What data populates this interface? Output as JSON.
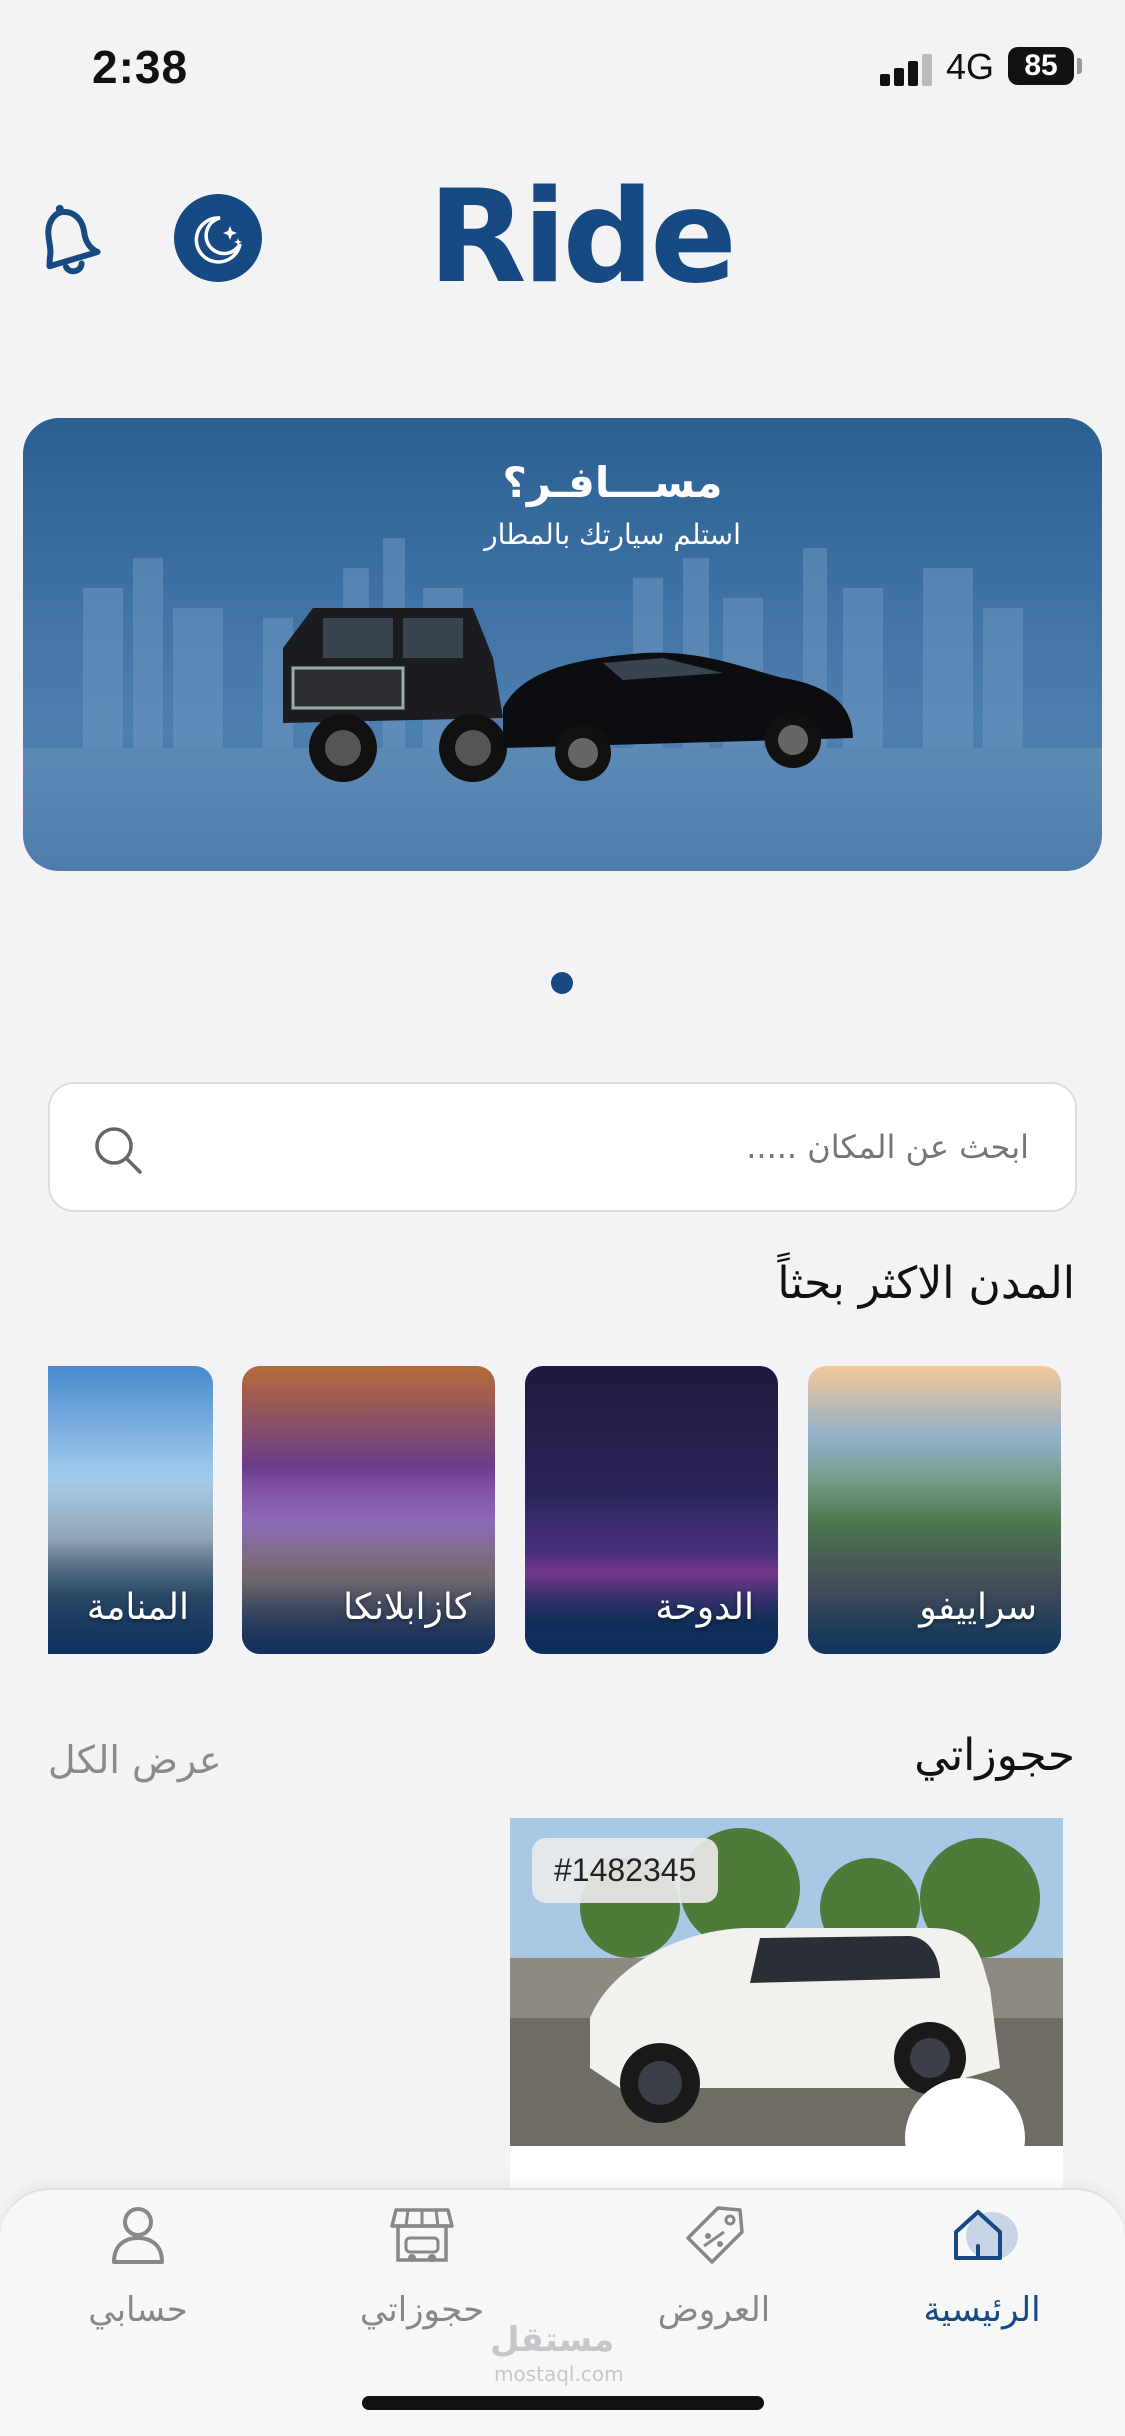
{
  "status_bar": {
    "time": "2:38",
    "network": "4G",
    "battery": "85"
  },
  "header": {
    "logo": "Ride"
  },
  "banner": {
    "title": "مســـافـر؟",
    "subtitle": "استلم سيارتك بالمطار"
  },
  "search": {
    "placeholder": "ابحث عن المكان ....."
  },
  "popular": {
    "title": "المدن الاكثر بحثاً",
    "cities": [
      {
        "name": "سراييفو"
      },
      {
        "name": "الدوحة"
      },
      {
        "name": "كازابلانكا"
      },
      {
        "name": "المنامة"
      }
    ]
  },
  "bookings": {
    "title": "حجوزاتي",
    "view_all": "عرض الكل",
    "items": [
      {
        "id": "#1482345"
      }
    ]
  },
  "tabbar": {
    "home": "الرئيسية",
    "offers": "العروض",
    "bookings": "حجوزاتي",
    "account": "حسابي"
  },
  "watermark": {
    "text": "مستقل",
    "sub": "mostaql.com"
  },
  "colors": {
    "primary": "#174a82",
    "background": "#f3f3f5",
    "muted": "#888888"
  }
}
